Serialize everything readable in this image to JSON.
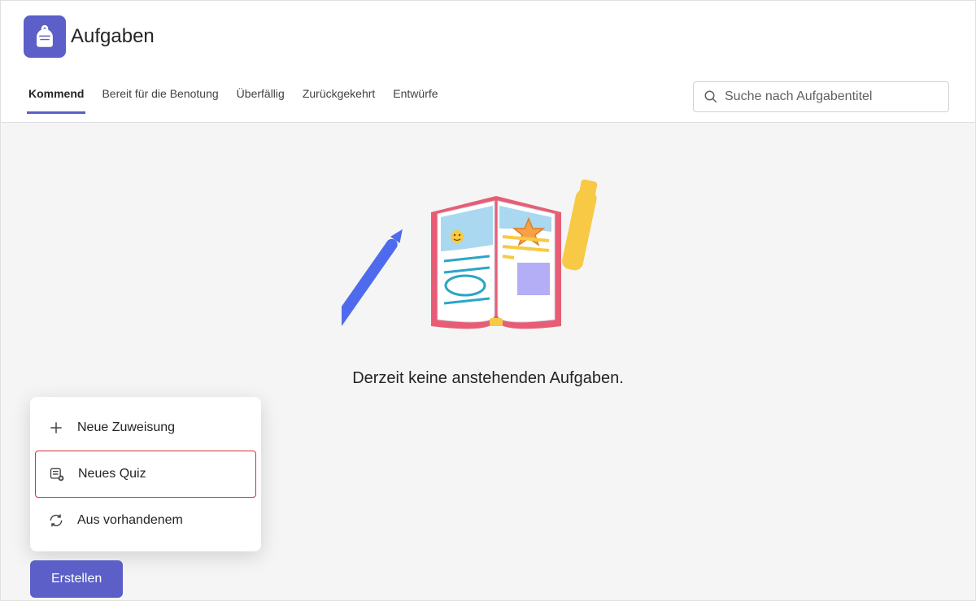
{
  "header": {
    "title": "Aufgaben"
  },
  "tabs": {
    "items": [
      {
        "label": "Kommend",
        "active": true
      },
      {
        "label": "Bereit für die Benotung",
        "active": false
      },
      {
        "label": "Überfällig",
        "active": false
      },
      {
        "label": "Zurückgekehrt",
        "active": false
      },
      {
        "label": "Entwürfe",
        "active": false
      }
    ]
  },
  "search": {
    "placeholder": "Suche nach Aufgabentitel"
  },
  "empty": {
    "message": "Derzeit keine anstehenden Aufgaben."
  },
  "create": {
    "button": "Erstellen",
    "menu": [
      {
        "label": "Neue Zuweisung",
        "icon": "plus-icon",
        "highlighted": false
      },
      {
        "label": "Neues Quiz",
        "icon": "quiz-icon",
        "highlighted": true
      },
      {
        "label": "Aus vorhandenem",
        "icon": "reuse-icon",
        "highlighted": false
      }
    ]
  }
}
